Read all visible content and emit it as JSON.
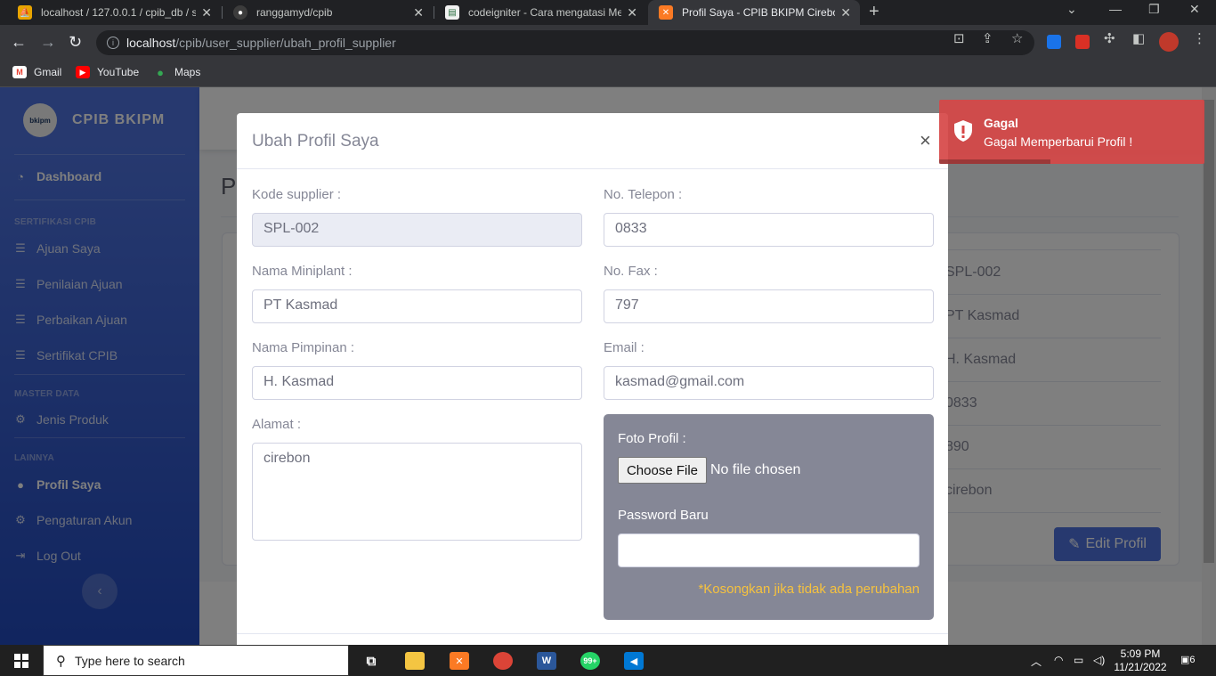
{
  "browser": {
    "tabs": [
      {
        "title": "localhost / 127.0.0.1 / cpib_db / s",
        "favicon": "phpmyadmin-icon"
      },
      {
        "title": "ranggamyd/cpib",
        "favicon": "github-icon"
      },
      {
        "title": "codeigniter - Cara mengatasi Me",
        "favicon": "stackoverflow-icon"
      },
      {
        "title": "Profil Saya - CPIB BKIPM Cirebon",
        "favicon": "xampp-icon",
        "active": true
      }
    ],
    "url_host": "localhost",
    "url_path": "/cpib/user_supplier/ubah_profil_supplier",
    "bookmarks": [
      {
        "label": "Gmail",
        "icon": "gmail-icon"
      },
      {
        "label": "YouTube",
        "icon": "youtube-icon"
      },
      {
        "label": "Maps",
        "icon": "maps-icon"
      }
    ]
  },
  "sidebar": {
    "brand": "CPIB BKIPM",
    "logo_text": "bkipm",
    "dashboard": "Dashboard",
    "section_sertifikasi": "SERTIFIKASI CPIB",
    "items_sertifikasi": [
      "Ajuan Saya",
      "Penilaian Ajuan",
      "Perbaikan Ajuan",
      "Sertifikat CPIB"
    ],
    "section_master": "MASTER DATA",
    "items_master": [
      "Jenis Produk"
    ],
    "section_lainnya": "LAINNYA",
    "items_lainnya": [
      "Profil Saya",
      "Pengaturan Akun",
      "Log Out"
    ]
  },
  "background_page": {
    "title_initial": "P",
    "card_values": [
      "SPL-002",
      "PT Kasmad",
      "H. Kasmad",
      "0833",
      "890",
      "cirebon"
    ],
    "edit_button": "Edit Profil"
  },
  "modal": {
    "title": "Ubah Profil Saya",
    "close": "×",
    "kode_label": "Kode supplier :",
    "kode_value": "SPL-002",
    "telepon_label": "No. Telepon :",
    "telepon_value": "0833",
    "miniplant_label": "Nama Miniplant :",
    "miniplant_value": "PT Kasmad",
    "fax_label": "No. Fax :",
    "fax_value": "797",
    "pimpinan_label": "Nama Pimpinan :",
    "pimpinan_value": "H. Kasmad",
    "email_label": "Email :",
    "email_value": "kasmad@gmail.com",
    "alamat_label": "Alamat :",
    "alamat_value": "cirebon",
    "foto_label": "Foto Profil :",
    "file_button": "Choose File",
    "file_status": "No file chosen",
    "password_label": "Password Baru",
    "password_hint": "*Kosongkan jika tidak ada perubahan"
  },
  "toast": {
    "title": "Gagal",
    "message": "Gagal Memperbarui Profil !"
  },
  "taskbar": {
    "search_placeholder": "Type here to search",
    "time": "5:09 PM",
    "date": "11/21/2022",
    "whatsapp_badge": "99+",
    "notification_count": "6"
  },
  "colors": {
    "sidebar_primary": "#4e73df",
    "toast_error": "#d64646",
    "hint_warning": "#f6c23e"
  }
}
